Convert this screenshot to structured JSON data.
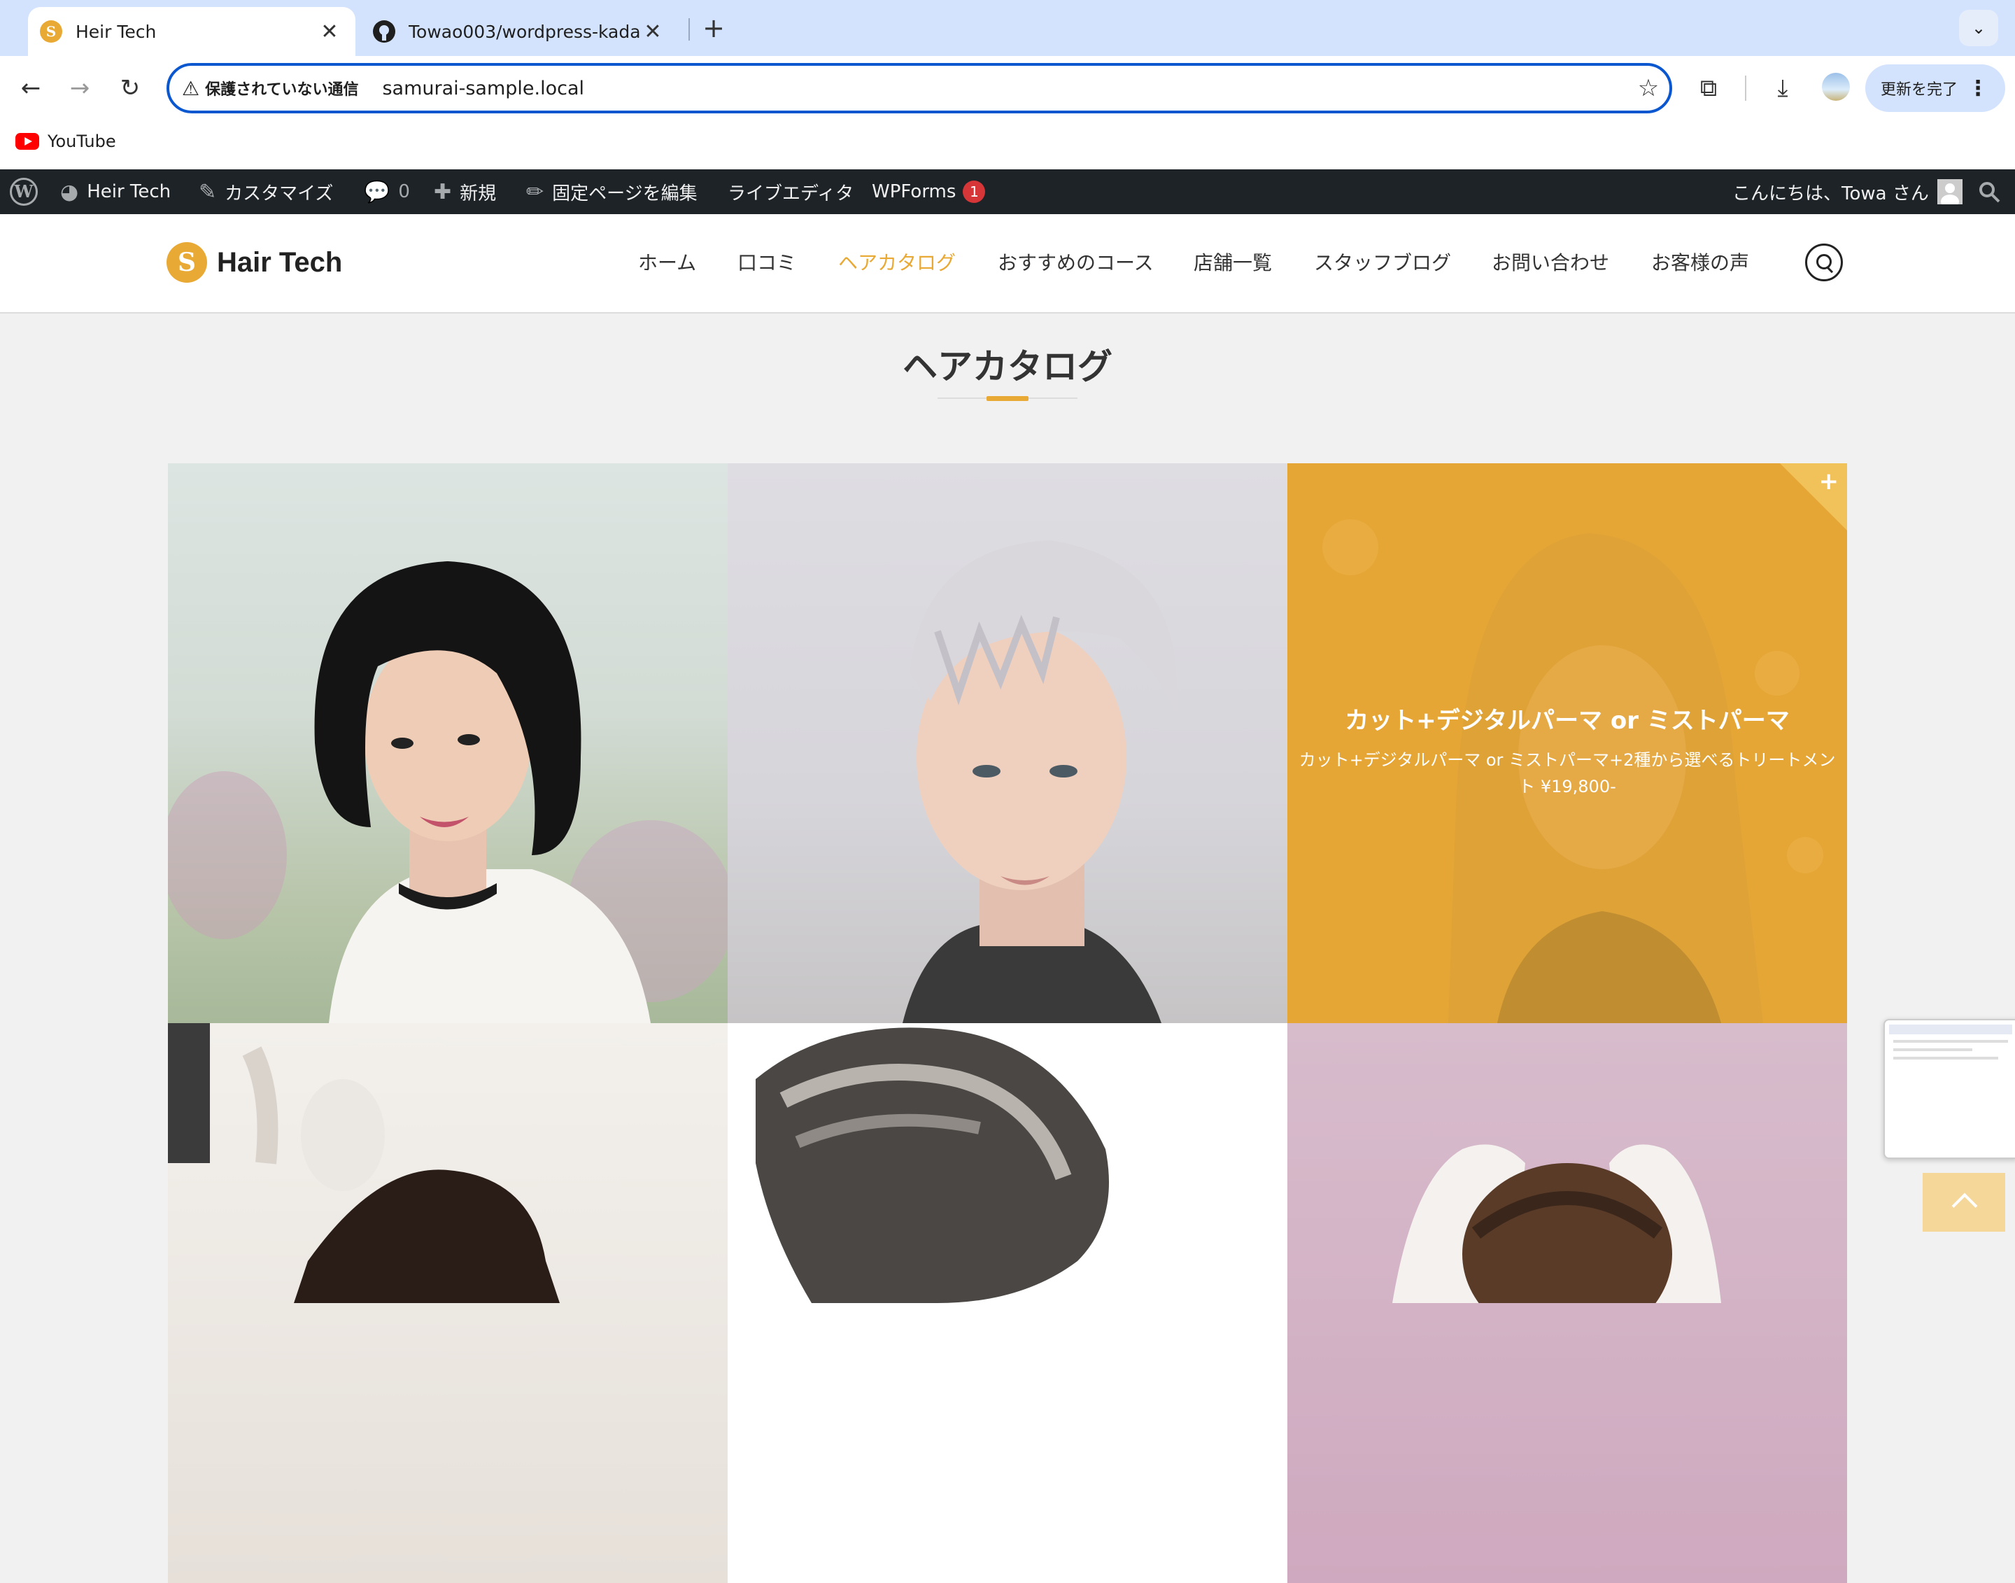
{
  "browser": {
    "tabs": [
      {
        "title": "Heir Tech",
        "active": true
      },
      {
        "title": "Towao003/wordpress-kadai",
        "active": false
      }
    ],
    "security_label": "保護されていない通信",
    "url": "samurai-sample.local",
    "update_button": "更新を完了",
    "bookmarks": [
      {
        "label": "YouTube"
      }
    ]
  },
  "admin_bar": {
    "site_name": "Heir Tech",
    "customize": "カスタマイズ",
    "comments_count": "0",
    "new": "新規",
    "edit_page": "固定ページを編集",
    "live_editor": "ライブエディタ",
    "wpforms": "WPForms",
    "wpforms_badge": "1",
    "greeting": "こんにちは、Towa さん"
  },
  "site": {
    "logo_text": "Hair Tech",
    "nav": [
      "ホーム",
      "口コミ",
      "ヘアカタログ",
      "おすすめのコース",
      "店舗一覧",
      "スタッフブログ",
      "お問い合わせ",
      "お客様の声"
    ],
    "nav_current_index": 2,
    "accent_color": "#e9a935"
  },
  "page": {
    "title": "ヘアカタログ",
    "catalog": [
      {
        "caption_title": "",
        "caption_desc": ""
      },
      {
        "caption_title": "",
        "caption_desc": ""
      },
      {
        "caption_title": "カット+デジタルパーマ or ミストパーマ",
        "caption_desc": "カット+デジタルパーマ or ミストパーマ+2種から選べるトリートメント ¥19,800-",
        "hovered": true
      },
      {
        "caption_title": "",
        "caption_desc": ""
      },
      {
        "caption_title": "",
        "caption_desc": ""
      },
      {
        "caption_title": "",
        "caption_desc": ""
      }
    ]
  }
}
